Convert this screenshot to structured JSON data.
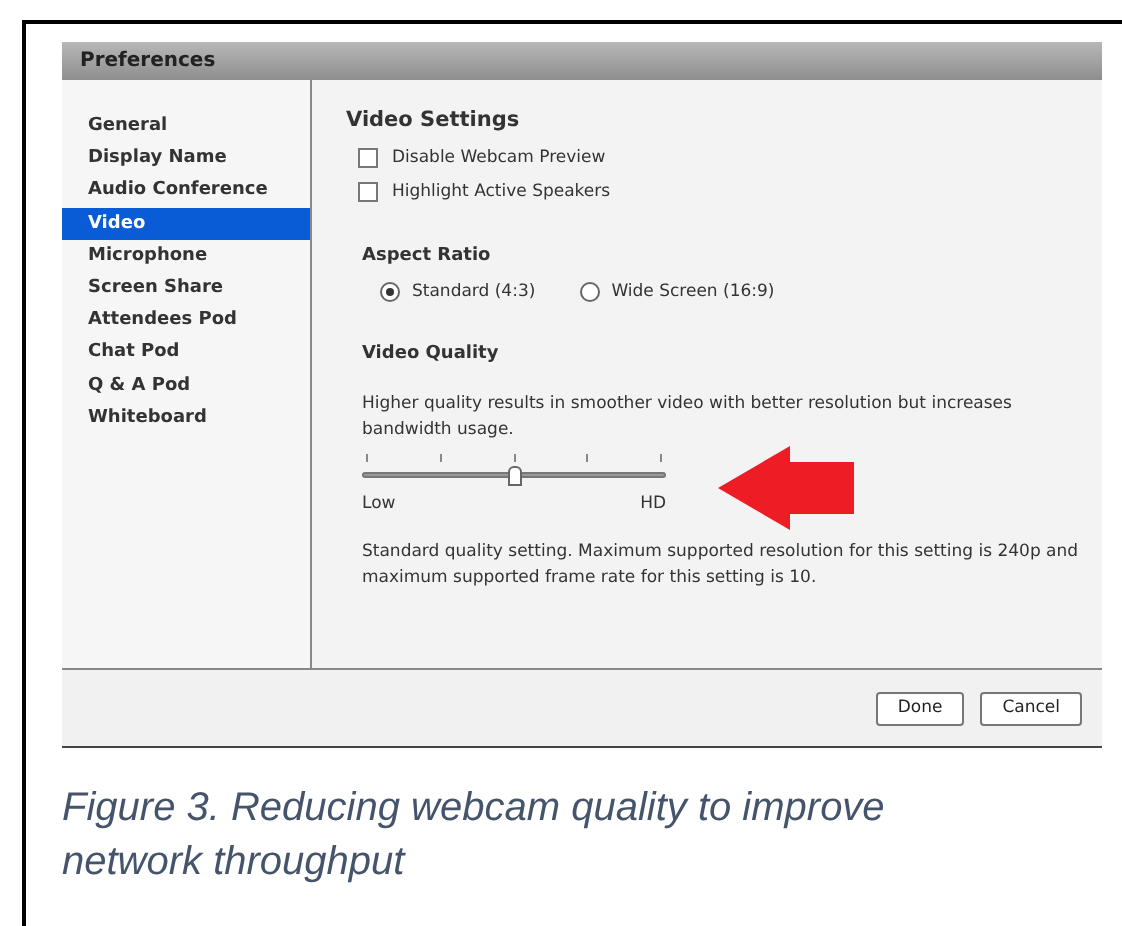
{
  "window": {
    "title": "Preferences"
  },
  "sidebar": {
    "items": [
      {
        "label": "General",
        "selected": false
      },
      {
        "label": "Display Name",
        "selected": false
      },
      {
        "label": "Audio Conference",
        "selected": false
      },
      {
        "label": "Video",
        "selected": true
      },
      {
        "label": "Microphone",
        "selected": false
      },
      {
        "label": "Screen Share",
        "selected": false
      },
      {
        "label": "Attendees Pod",
        "selected": false
      },
      {
        "label": "Chat Pod",
        "selected": false
      },
      {
        "label": "Q & A Pod",
        "selected": false
      },
      {
        "label": "Whiteboard",
        "selected": false
      }
    ]
  },
  "video_settings": {
    "heading": "Video Settings",
    "options": [
      {
        "label": "Disable Webcam Preview",
        "checked": false
      },
      {
        "label": "Highlight Active Speakers",
        "checked": false
      }
    ]
  },
  "aspect_ratio": {
    "heading": "Aspect Ratio",
    "options": [
      {
        "label": "Standard (4:3)",
        "selected": true
      },
      {
        "label": "Wide Screen (16:9)",
        "selected": false
      }
    ]
  },
  "video_quality": {
    "heading": "Video Quality",
    "description": "Higher quality results in smoother video with better resolution but increases bandwidth usage.",
    "slider": {
      "level": 0.5,
      "min_label": "Low",
      "max_label": "HD"
    },
    "note": "Standard quality setting. Maximum supported resolution for this setting is 240p and maximum supported frame rate for this setting is 10."
  },
  "buttons": [
    "Done",
    "Cancel"
  ],
  "caption": "Figure 3. Reducing webcam quality to improve network throughput"
}
